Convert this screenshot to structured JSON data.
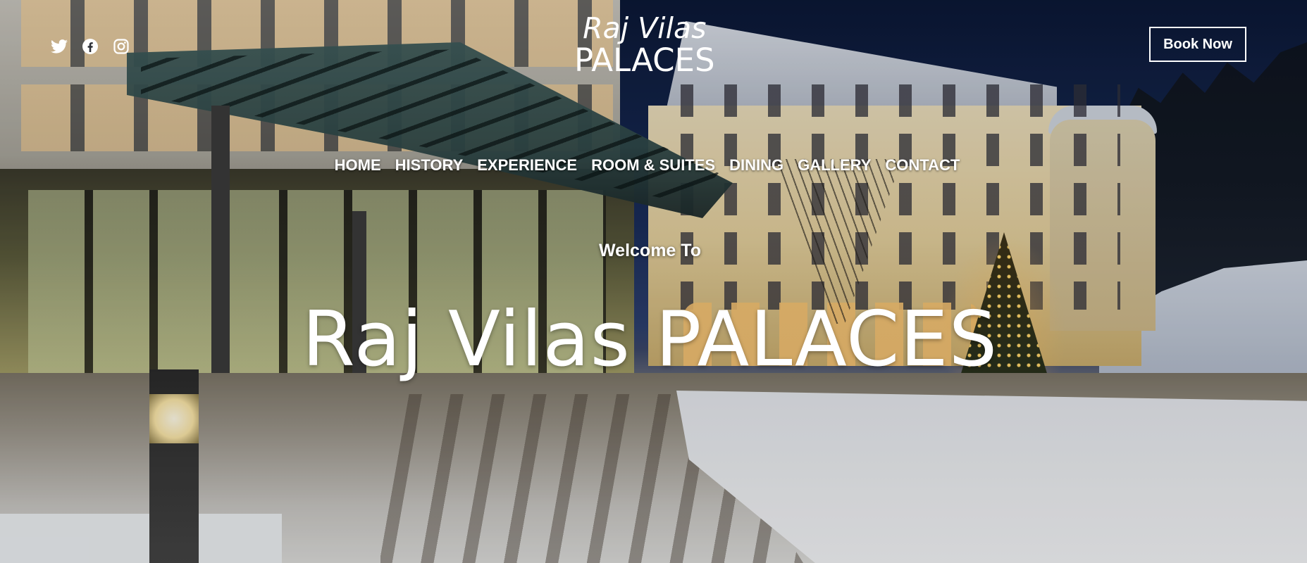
{
  "site": {
    "logo": {
      "line1": "Raj Vilas",
      "line2": "PALACES"
    },
    "social": [
      "twitter-icon",
      "facebook-icon",
      "instagram-icon"
    ],
    "book_button": "Book Now"
  },
  "nav": {
    "items": [
      {
        "label": "HOME"
      },
      {
        "label": "HISTORY"
      },
      {
        "label": "EXPERIENCE"
      },
      {
        "label": "ROOM & SUITES"
      },
      {
        "label": "DINING"
      },
      {
        "label": "GALLERY"
      },
      {
        "label": "CONTACT"
      }
    ]
  },
  "hero": {
    "welcome": "Welcome To",
    "title": "Raj Vilas PALACES"
  },
  "colors": {
    "text": "#ffffff",
    "button_border": "#ffffff"
  }
}
